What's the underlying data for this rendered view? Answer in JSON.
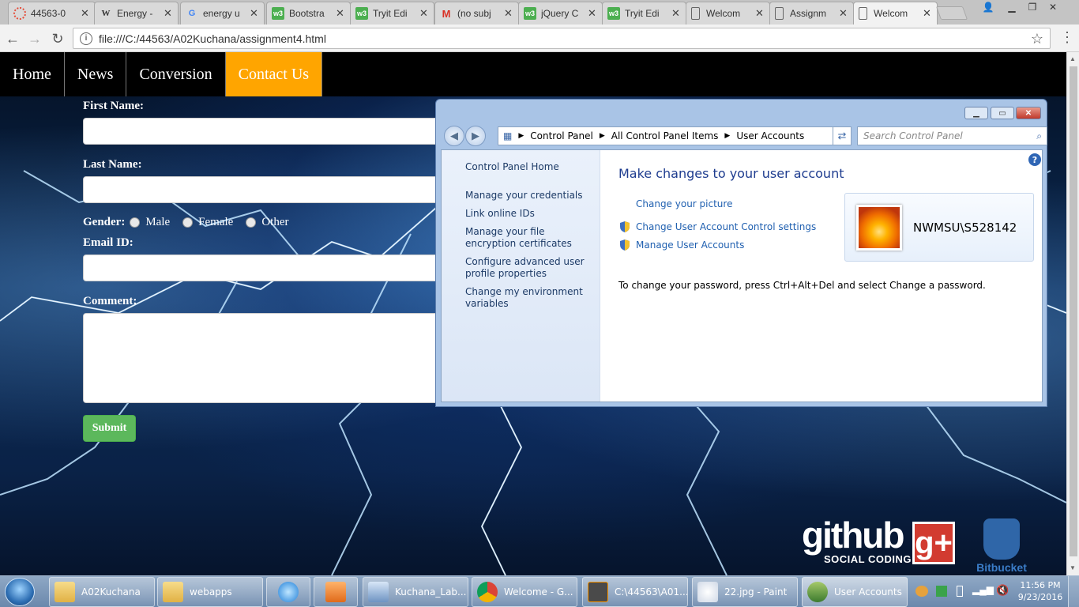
{
  "browser": {
    "tabs": [
      {
        "label": "44563-0",
        "icon": "red-circle-icon",
        "color": "#e44d3a"
      },
      {
        "label": "Energy -",
        "icon": "wikipedia-icon",
        "color": "#000000"
      },
      {
        "label": "energy u",
        "icon": "google-icon",
        "color": "#4285f4"
      },
      {
        "label": "Bootstra",
        "icon": "w3schools-icon",
        "color": "#4caf50"
      },
      {
        "label": "Tryit Edi",
        "icon": "w3schools-icon",
        "color": "#4caf50"
      },
      {
        "label": "(no subj",
        "icon": "gmail-icon",
        "color": "#d93025"
      },
      {
        "label": "jQuery C",
        "icon": "w3schools-icon",
        "color": "#4caf50"
      },
      {
        "label": "Tryit Edi",
        "icon": "w3schools-icon",
        "color": "#4caf50"
      },
      {
        "label": "Welcom",
        "icon": "page-icon",
        "color": "#666666"
      },
      {
        "label": "Assignm",
        "icon": "page-icon",
        "color": "#666666"
      },
      {
        "label": "Welcom",
        "icon": "page-icon",
        "color": "#666666"
      }
    ],
    "url": "file:///C:/44563/A02Kuchana/assignment4.html"
  },
  "site": {
    "nav": [
      "Home",
      "News",
      "Conversion",
      "Contact Us"
    ],
    "active_nav": "Contact Us",
    "accent": "#ffa500",
    "form": {
      "first_name_label": "First Name:",
      "last_name_label": "Last Name:",
      "gender_label": "Gender:",
      "gender_options": [
        "Male",
        "Female",
        "Other"
      ],
      "email_label": "Email ID:",
      "comment_label": "Comment:",
      "submit_label": "Submit",
      "submit_color": "#5cb85c"
    },
    "github": {
      "brand": "github",
      "tagline": "SOCIAL CODING",
      "gplus": "g+"
    },
    "bitbucket": "Bitbucket"
  },
  "control_panel": {
    "breadcrumb": [
      "Control Panel",
      "All Control Panel Items",
      "User Accounts"
    ],
    "search_placeholder": "Search Control Panel",
    "left_links": [
      "Control Panel Home",
      "Manage your credentials",
      "Link online IDs",
      "Manage your file encryption certificates",
      "Configure advanced user profile properties",
      "Change my environment variables"
    ],
    "title": "Make changes to your user account",
    "links": [
      "Change your picture",
      "Change User Account Control settings",
      "Manage User Accounts"
    ],
    "username": "NWMSU\\S528142",
    "password_note": "To change your password, press Ctrl+Alt+Del and select Change a password."
  },
  "taskbar": {
    "buttons": [
      {
        "label": "A02Kuchana",
        "icon": "folder-icon"
      },
      {
        "label": "webapps",
        "icon": "folder-icon"
      },
      {
        "label": "",
        "icon": "internet-explorer-icon"
      },
      {
        "label": "",
        "icon": "media-player-icon"
      },
      {
        "label": "Kuchana_Lab...",
        "icon": "virtualbox-icon"
      },
      {
        "label": "Welcome - G...",
        "icon": "chrome-icon"
      },
      {
        "label": "C:\\44563\\A01...",
        "icon": "sublime-icon"
      },
      {
        "label": "22.jpg - Paint",
        "icon": "paint-icon"
      },
      {
        "label": "User Accounts",
        "icon": "user-accounts-icon"
      }
    ],
    "time": "11:56 PM",
    "date": "9/23/2016"
  }
}
